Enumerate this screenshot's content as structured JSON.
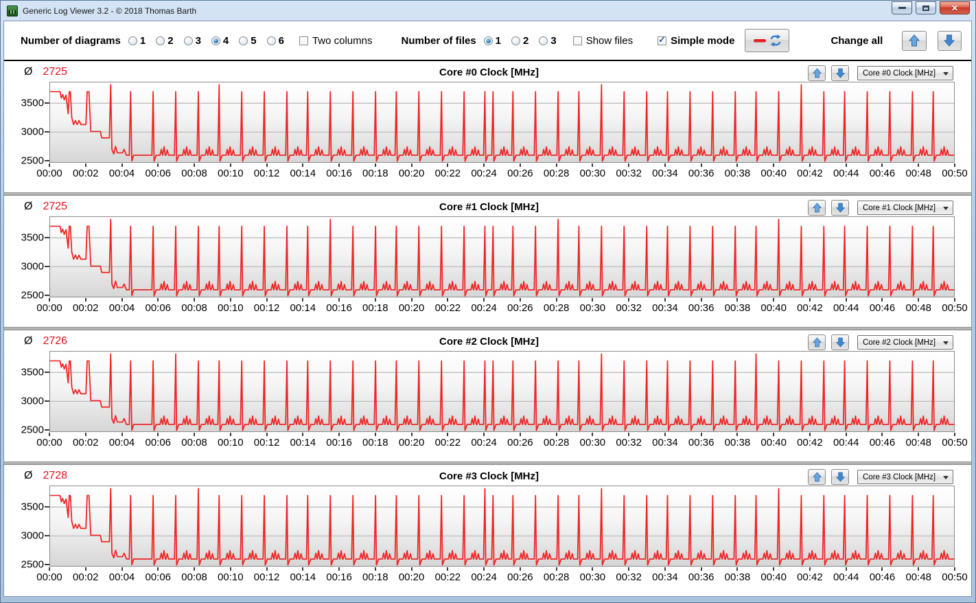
{
  "window": {
    "title": "Generic Log Viewer 3.2 - © 2018 Thomas Barth",
    "controls": {
      "minimize": "minimize",
      "maximize": "maximize",
      "close": "close"
    }
  },
  "toolbar": {
    "diagrams_label": "Number of diagrams",
    "diagram_options": [
      "1",
      "2",
      "3",
      "4",
      "5",
      "6"
    ],
    "diagram_selected": "4",
    "two_columns_label": "Two columns",
    "two_columns_checked": false,
    "files_label": "Number of files",
    "file_options": [
      "1",
      "2",
      "3"
    ],
    "file_selected": "1",
    "show_files_label": "Show files",
    "show_files_checked": false,
    "simple_mode_label": "Simple mode",
    "simple_mode_checked": true,
    "change_all_label": "Change all"
  },
  "panels": [
    {
      "avg_symbol": "Ø",
      "avg": "2725",
      "title": "Core #0 Clock [MHz]",
      "dropdown_value": "Core #0 Clock [MHz]"
    },
    {
      "avg_symbol": "Ø",
      "avg": "2725",
      "title": "Core #1 Clock [MHz]",
      "dropdown_value": "Core #1 Clock [MHz]"
    },
    {
      "avg_symbol": "Ø",
      "avg": "2726",
      "title": "Core #2 Clock [MHz]",
      "dropdown_value": "Core #2 Clock [MHz]"
    },
    {
      "avg_symbol": "Ø",
      "avg": "2728",
      "title": "Core #3 Clock [MHz]",
      "dropdown_value": "Core #3 Clock [MHz]"
    }
  ],
  "chart_data": {
    "type": "line",
    "x_unit": "minutes",
    "x_range": [
      0,
      50
    ],
    "ylim": [
      2480,
      3860
    ],
    "yticks": [
      "3500",
      "3000",
      "2500"
    ],
    "ytick_values": [
      3500,
      3000,
      2500
    ],
    "grid_values": [
      3500,
      3000
    ],
    "xtick_labels": [
      "00:00",
      "00:02",
      "00:04",
      "00:06",
      "00:08",
      "00:10",
      "00:12",
      "00:14",
      "00:16",
      "00:18",
      "00:20",
      "00:22",
      "00:24",
      "00:26",
      "00:28",
      "00:30",
      "00:32",
      "00:34",
      "00:36",
      "00:38",
      "00:40",
      "00:42",
      "00:44",
      "00:46",
      "00:48",
      "00:50"
    ],
    "line_color": "#f02424",
    "grid_color": "#a9a9a9",
    "shared_series": {
      "initial_points": [
        [
          0,
          3700
        ],
        [
          0.55,
          3700
        ],
        [
          0.62,
          3590
        ],
        [
          0.7,
          3650
        ],
        [
          0.78,
          3560
        ],
        [
          0.88,
          3640
        ],
        [
          1.0,
          3320
        ],
        [
          1.06,
          3700
        ],
        [
          1.12,
          3700
        ],
        [
          1.2,
          3250
        ],
        [
          1.3,
          3130
        ],
        [
          1.4,
          3200
        ],
        [
          1.5,
          3130
        ],
        [
          1.6,
          3200
        ],
        [
          1.7,
          3130
        ],
        [
          1.98,
          3130
        ],
        [
          2.05,
          3700
        ],
        [
          2.15,
          3700
        ],
        [
          2.25,
          3010
        ],
        [
          2.78,
          3010
        ],
        [
          2.85,
          2900
        ],
        [
          3.28,
          2900
        ],
        [
          3.35,
          3820
        ],
        [
          3.42,
          2700
        ],
        [
          3.52,
          2620
        ],
        [
          3.62,
          2750
        ],
        [
          3.72,
          2640
        ],
        [
          4.0,
          2640
        ],
        [
          4.1,
          2700
        ],
        [
          4.22,
          2600
        ],
        [
          4.38,
          2600
        ],
        [
          4.45,
          3700
        ],
        [
          4.52,
          2500
        ],
        [
          4.62,
          2600
        ]
      ],
      "baseline": 2600,
      "spike_times_min": [
        5.7,
        6.95,
        8.2,
        9.35,
        10.6,
        11.85,
        13.1,
        14.25,
        15.5,
        16.75,
        18.0,
        19.15,
        20.4,
        21.65,
        22.9,
        24.05,
        24.5,
        25.6,
        26.85,
        28.1,
        29.25,
        30.5,
        31.75,
        33.0,
        34.15,
        35.4,
        36.65,
        37.9,
        39.05,
        40.3,
        41.55,
        42.8,
        43.95,
        45.2,
        46.45,
        47.7,
        48.85
      ],
      "default_peak": 3700,
      "tall_peak": 3820,
      "spike_drop": 2495,
      "bumps": [
        [
          0.45,
          2700
        ],
        [
          0.6,
          2745
        ],
        [
          0.78,
          2690
        ]
      ]
    },
    "charts": [
      {
        "name": "Core #0 Clock [MHz]",
        "average_mhz": 2725,
        "tall_spike_indices": [
          3,
          21,
          30
        ]
      },
      {
        "name": "Core #1 Clock [MHz]",
        "average_mhz": 2725,
        "tall_spike_indices": [
          8,
          19,
          29
        ]
      },
      {
        "name": "Core #2 Clock [MHz]",
        "average_mhz": 2726,
        "tall_spike_indices": [
          1,
          21,
          28
        ]
      },
      {
        "name": "Core #3 Clock [MHz]",
        "average_mhz": 2728,
        "tall_spike_indices": [
          2,
          15,
          21,
          29
        ]
      }
    ]
  }
}
